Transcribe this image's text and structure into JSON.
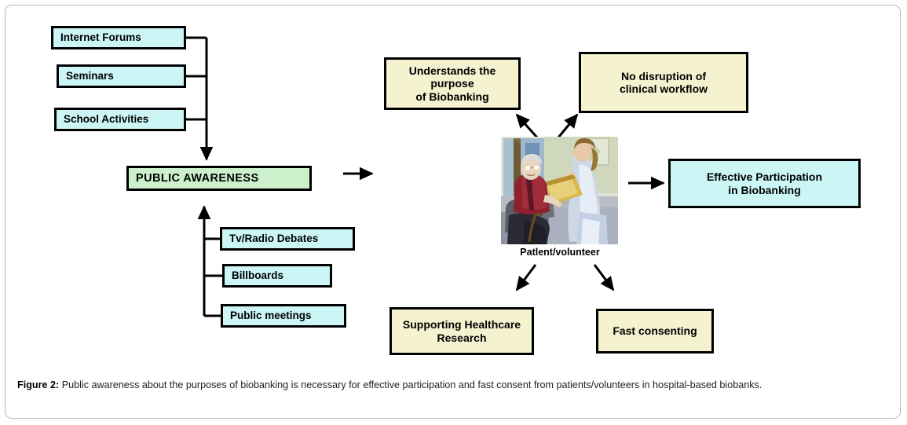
{
  "figure": {
    "caption_label": "Figure 2:",
    "caption_text": "Public awareness about the purposes of biobanking is necessary for effective participation and fast consent from patients/volunteers in hospital-based biobanks."
  },
  "colors": {
    "cyan_fill": "#ccf5f5",
    "green_fill": "#ccf0cc",
    "yellow_fill": "#f5f2d0",
    "border": "#000000",
    "frame": "#b9b9b9"
  },
  "diagram": {
    "awareness_inputs_top": [
      {
        "label": "Internet Forums"
      },
      {
        "label": "Seminars"
      },
      {
        "label": "School Activities"
      }
    ],
    "hub": {
      "label": "PUBLIC AWARENESS"
    },
    "awareness_inputs_bottom": [
      {
        "label": "Tv/Radio Debates"
      },
      {
        "label": "Billboards"
      },
      {
        "label": "Public meetings"
      }
    ],
    "actor": {
      "caption": "Patlent/volunteer",
      "image_alt": "patient-volunteer-illustration"
    },
    "outcomes": [
      {
        "label": "Understands the\npurpose\nof Biobanking",
        "line1": "Understands the",
        "line2": "purpose",
        "line3": "of Biobanking"
      },
      {
        "label": "No disruption of\nclinical workflow",
        "line1": "No disruption of",
        "line2": "clinical workflow"
      },
      {
        "label": "Effective Participation\nin Biobanking",
        "line1": "Effective Participation",
        "line2": "in Biobanking"
      },
      {
        "label": "Supporting Healthcare\nResearch",
        "line1": "Supporting Healthcare",
        "line2": "Research"
      },
      {
        "label": "Fast consenting",
        "line1": "Fast consenting"
      }
    ]
  }
}
